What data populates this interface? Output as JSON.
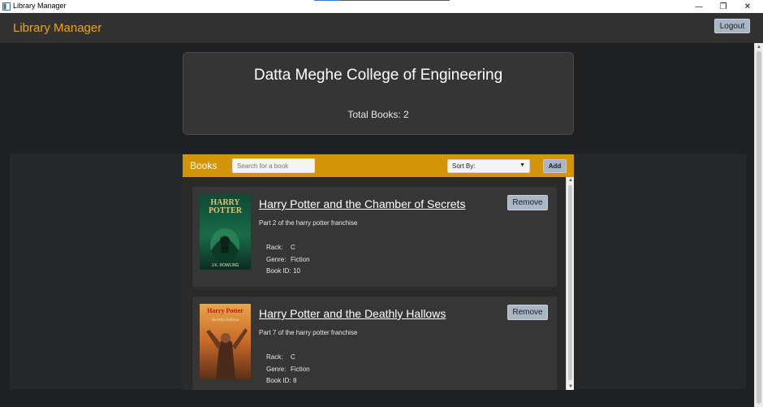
{
  "window": {
    "title": "Library Manager",
    "minimize_glyph": "—",
    "restore_glyph": "❐",
    "close_glyph": "✕"
  },
  "header": {
    "brand": "Library Manager",
    "logout_label": "Logout",
    "brand_color": "#f0a30a"
  },
  "college": {
    "name": "Datta Meghe College of Engineering",
    "total_books": "Total Books: 2"
  },
  "books_panel": {
    "title": "Books",
    "search_placeholder": "Search for a book",
    "sort_label": "Sort By:",
    "add_label": "Add",
    "accent_color": "#d39407"
  },
  "books": [
    {
      "title": "Harry Potter and the Chamber of Secrets",
      "description": "Part 2 of the harry potter franchise",
      "rack_label": "Rack:",
      "rack": "C",
      "genre_label": "Genre:",
      "genre": "Fiction",
      "id_label": "Book ID:",
      "id": "10",
      "remove_label": "Remove",
      "cover_title_line1": "HARRY",
      "cover_title_line2": "POTTER",
      "cover_author": "J.K. ROWLING"
    },
    {
      "title": "Harry Potter and the Deathly Hallows",
      "description": "Part 7 of the harry potter franchise",
      "rack_label": "Rack:",
      "rack": "C",
      "genre_label": "Genre:",
      "genre": "Fiction",
      "id_label": "Book ID:",
      "id": "8",
      "remove_label": "Remove",
      "cover_title_line1": "Harry Potter",
      "cover_title_line2": "Deathly Hallows"
    }
  ]
}
